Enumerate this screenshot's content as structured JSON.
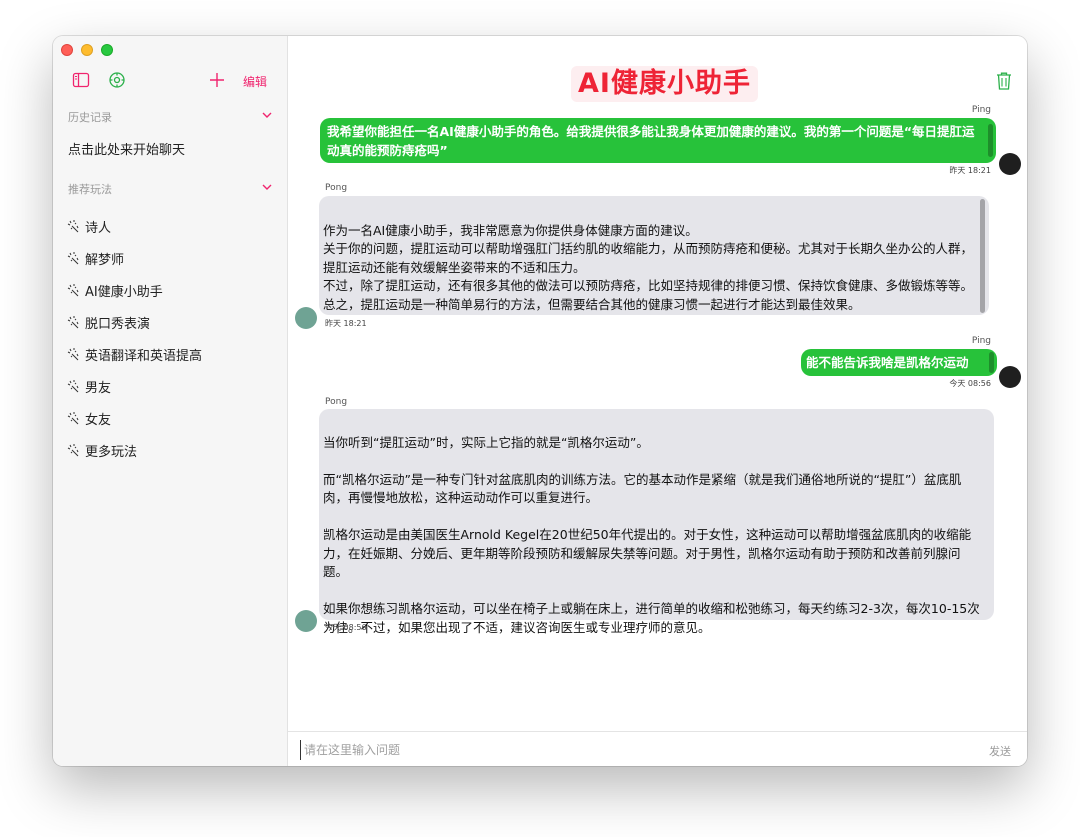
{
  "sidebar": {
    "edit_label": "编辑",
    "history_label": "历史记录",
    "history_items": [
      "点击此处来开始聊天"
    ],
    "recommend_label": "推荐玩法",
    "recommend_items": [
      "诗人",
      "解梦师",
      "AI健康小助手",
      "脱口秀表演",
      "英语翻译和英语提高",
      "男友",
      "女友",
      "更多玩法"
    ]
  },
  "main": {
    "title": "AI健康小助手",
    "messages": [
      {
        "sender": "Ping",
        "text": "我希望你能担任一名AI健康小助手的角色。给我提供很多能让我身体更加健康的建议。我的第一个问题是“每日提肛运动真的能预防痔疮吗”",
        "time": "昨天 18:21"
      },
      {
        "sender": "Pong",
        "text": "作为一名AI健康小助手，我非常愿意为你提供身体健康方面的建议。\n关于你的问题，提肛运动可以帮助增强肛门括约肌的收缩能力，从而预防痔疮和便秘。尤其对于长期久坐办公的人群，提肛运动还能有效缓解坐姿带来的不适和压力。\n不过，除了提肛运动，还有很多其他的做法可以预防痔疮，比如坚持规律的排便习惯、保持饮食健康、多做锻炼等等。\n总之，提肛运动是一种简单易行的方法，但需要结合其他的健康习惯一起进行才能达到最佳效果。",
        "time": "昨天 18:21"
      },
      {
        "sender": "Ping",
        "text": "能不能告诉我啥是凯格尔运动",
        "time": "今天 08:56"
      },
      {
        "sender": "Pong",
        "text": "当你听到“提肛运动”时，实际上它指的就是“凯格尔运动”。\n\n而“凯格尔运动”是一种专门针对盆底肌肉的训练方法。它的基本动作是紧缩（就是我们通俗地所说的“提肛”）盆底肌肉，再慢慢地放松，这种运动动作可以重复进行。\n\n凯格尔运动是由美国医生Arnold Kegel在20世纪50年代提出的。对于女性，这种运动可以帮助增强盆底肌肉的收缩能力，在妊娠期、分娩后、更年期等阶段预防和缓解尿失禁等问题。对于男性，凯格尔运动有助于预防和改善前列腺问题。\n\n如果你想练习凯格尔运动，可以坐在椅子上或躺在床上，进行简单的收缩和松弛练习，每天约练习2-3次，每次10-15次为佳。不过，如果您出现了不适，建议咨询医生或专业理疗师的意见。",
        "time": "今天 08:56"
      }
    ],
    "input_placeholder": "请在这里输入问题",
    "send_label": "发送"
  },
  "colors": {
    "accent": "#f0246e",
    "title_red": "#ee2436",
    "outgoing_bubble": "#27c23a",
    "incoming_bubble": "#e5e5ea"
  },
  "icons": [
    "sidebar-toggle-icon",
    "settings-icon",
    "plus-icon",
    "chevron-down-icon",
    "sparkle-icon",
    "trash-icon"
  ]
}
